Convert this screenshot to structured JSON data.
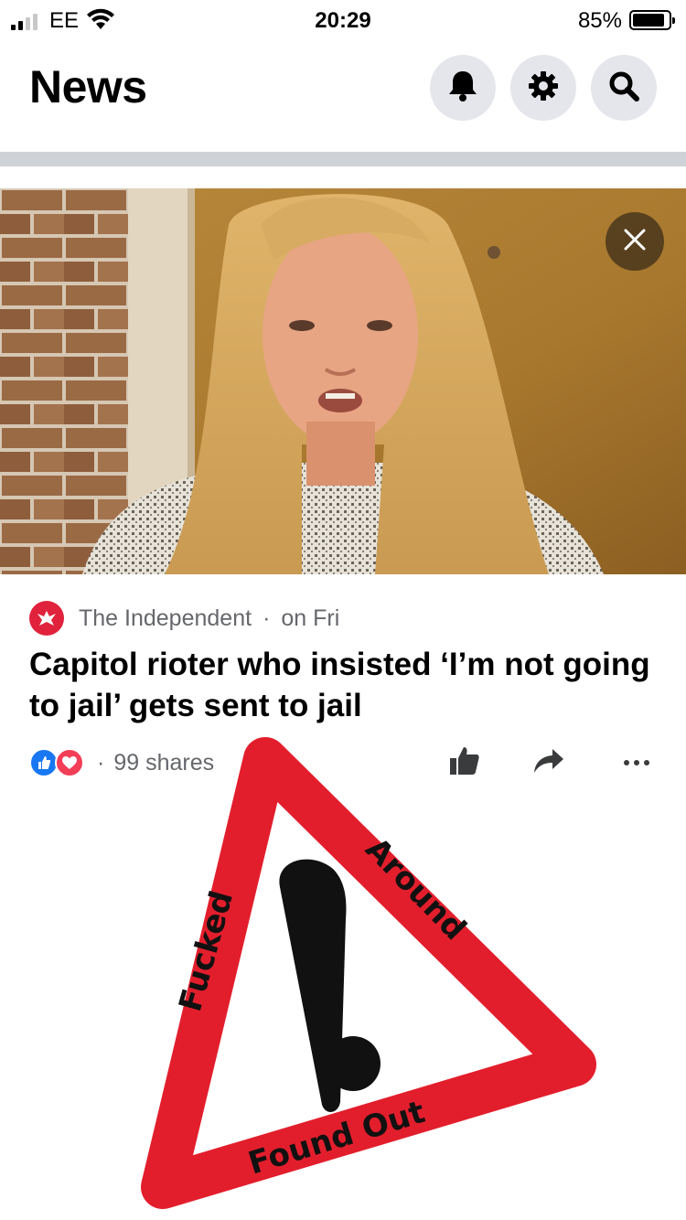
{
  "status_bar": {
    "carrier": "EE",
    "time": "20:29",
    "battery_percent": "85%",
    "battery_level": 0.85,
    "signal_bars": 2
  },
  "header": {
    "title": "News",
    "icons": [
      "bell-icon",
      "gear-icon",
      "search-icon"
    ]
  },
  "article": {
    "source": "The Independent",
    "separator": "·",
    "time": "on Fri",
    "headline": "Capitol rioter who insisted ‘I’m not going to jail’ gets sent to jail",
    "shares_separator": "·",
    "shares": "99 shares",
    "reactions": [
      "like",
      "love"
    ]
  },
  "meme": {
    "left_text": "Fucked",
    "right_text": "Around",
    "bottom_text": "Found Out"
  },
  "colors": {
    "accent_blue": "#1877f2",
    "love_red": "#f33e58",
    "warning_red": "#e31e2c",
    "secondary_text": "#65676b",
    "button_bg": "#e4e6eb"
  }
}
